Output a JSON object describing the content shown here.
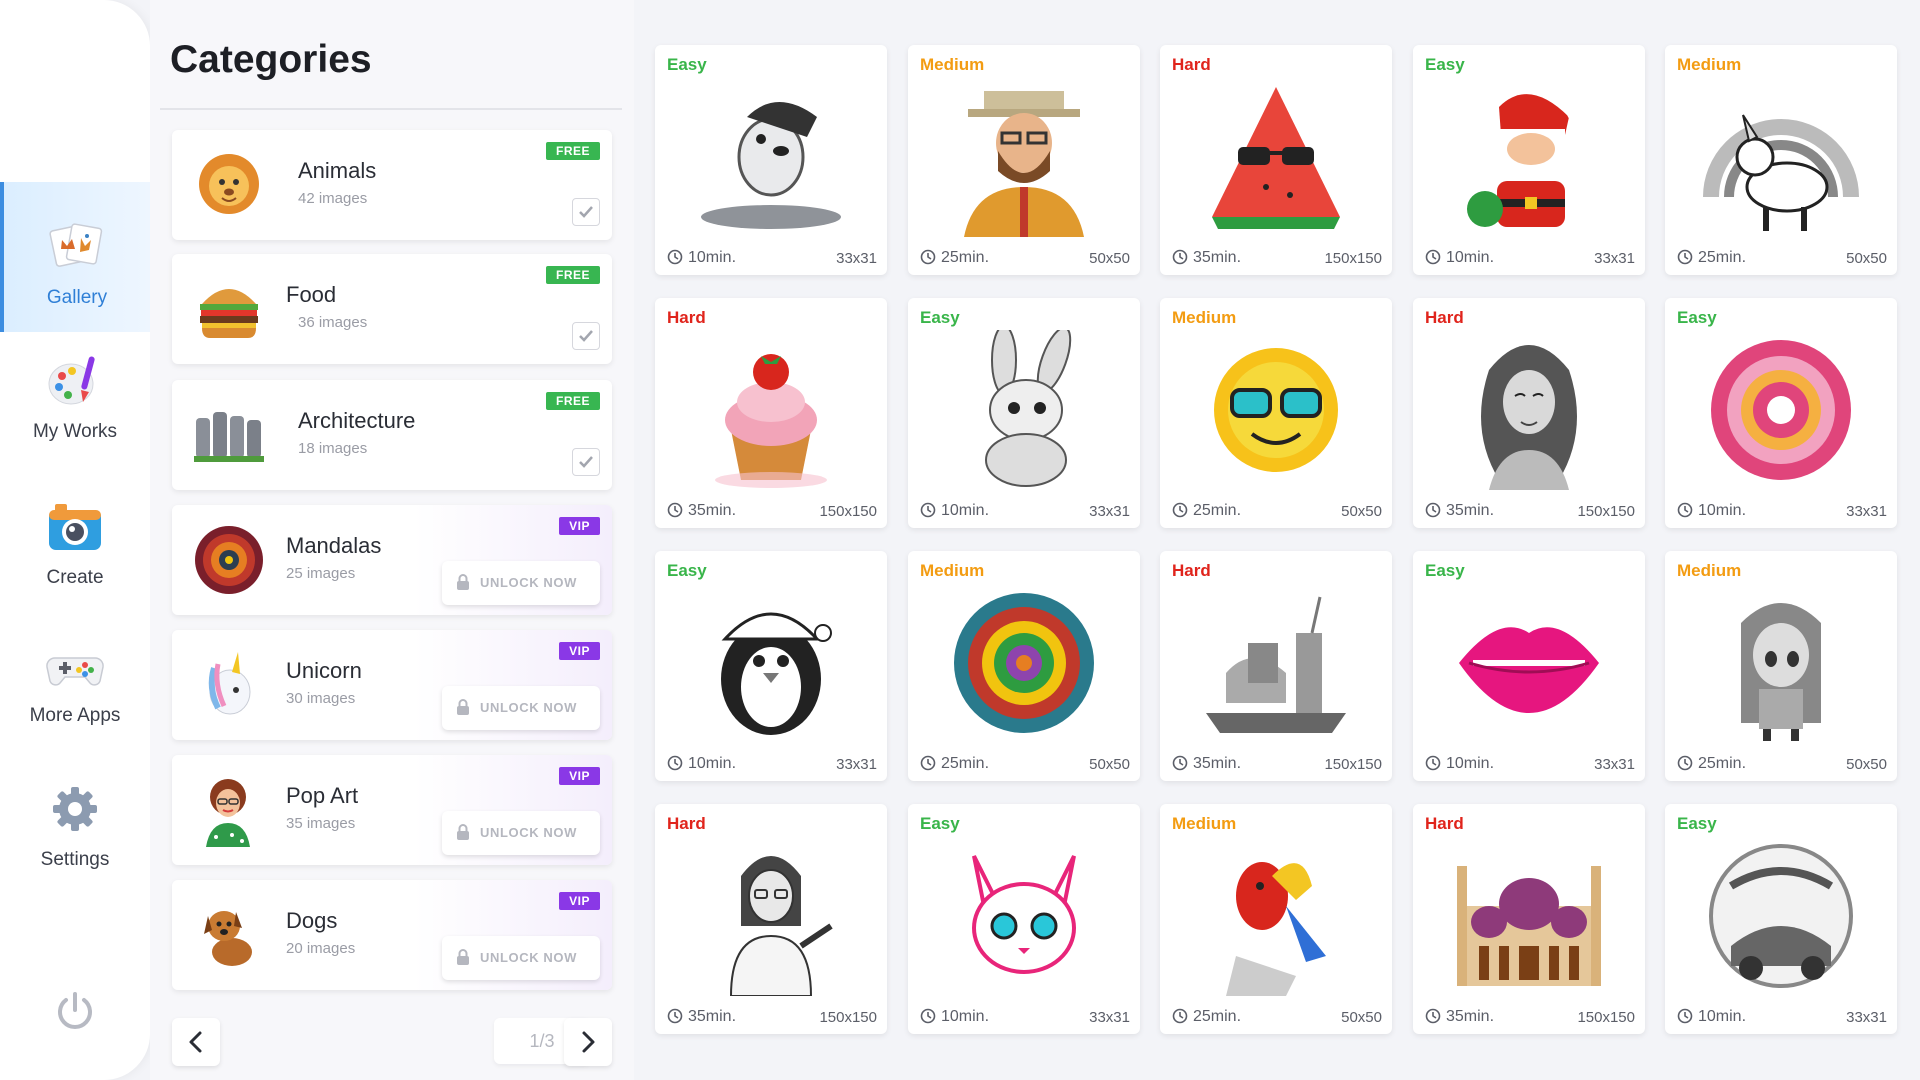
{
  "nav": {
    "items": [
      {
        "label": "Gallery",
        "icon": "gallery-icon",
        "active": true
      },
      {
        "label": "My Works",
        "icon": "palette-icon",
        "active": false
      },
      {
        "label": "Create",
        "icon": "camera-icon",
        "active": false
      },
      {
        "label": "More Apps",
        "icon": "gamepad-icon",
        "active": false
      },
      {
        "label": "Settings",
        "icon": "gear-icon",
        "active": false
      }
    ],
    "power_icon": "power-icon"
  },
  "categories": {
    "title": "Categories",
    "items": [
      {
        "name": "Animals",
        "count": "42 images",
        "badge": "FREE",
        "thumb": "lion"
      },
      {
        "name": "Food",
        "count": "36 images",
        "badge": "FREE",
        "thumb": "burger"
      },
      {
        "name": "Architecture",
        "count": "18 images",
        "badge": "FREE",
        "thumb": "moai"
      },
      {
        "name": "Mandalas",
        "count": "25 images",
        "badge": "VIP",
        "unlock": "UNLOCK NOW",
        "thumb": "mandala"
      },
      {
        "name": "Unicorn",
        "count": "30 images",
        "badge": "VIP",
        "unlock": "UNLOCK NOW",
        "thumb": "unicorn"
      },
      {
        "name": "Pop Art",
        "count": "35 images",
        "badge": "VIP",
        "unlock": "UNLOCK NOW",
        "thumb": "popart-woman"
      },
      {
        "name": "Dogs",
        "count": "20 images",
        "badge": "VIP",
        "unlock": "UNLOCK NOW",
        "thumb": "dog"
      }
    ],
    "pagination": {
      "indicator": "1/3"
    }
  },
  "gallery": [
    {
      "difficulty": "Easy",
      "time": "10min.",
      "size": "33x31",
      "art": "surfing-dog"
    },
    {
      "difficulty": "Medium",
      "time": "25min.",
      "size": "50x50",
      "art": "bearded-man"
    },
    {
      "difficulty": "Hard",
      "time": "35min.",
      "size": "150x150",
      "art": "watermelon-sunglasses"
    },
    {
      "difficulty": "Easy",
      "time": "10min.",
      "size": "33x31",
      "art": "santa-claus"
    },
    {
      "difficulty": "Medium",
      "time": "25min.",
      "size": "50x50",
      "art": "unicorn-rainbow"
    },
    {
      "difficulty": "Hard",
      "time": "35min.",
      "size": "150x150",
      "art": "cupcake"
    },
    {
      "difficulty": "Easy",
      "time": "10min.",
      "size": "33x31",
      "art": "bunny"
    },
    {
      "difficulty": "Medium",
      "time": "25min.",
      "size": "50x50",
      "art": "sun-sunglasses"
    },
    {
      "difficulty": "Hard",
      "time": "35min.",
      "size": "150x150",
      "art": "woman-portrait"
    },
    {
      "difficulty": "Easy",
      "time": "10min.",
      "size": "33x31",
      "art": "pink-mandala"
    },
    {
      "difficulty": "Easy",
      "time": "10min.",
      "size": "33x31",
      "art": "penguin-hat"
    },
    {
      "difficulty": "Medium",
      "time": "25min.",
      "size": "50x50",
      "art": "feather-mandala"
    },
    {
      "difficulty": "Hard",
      "time": "35min.",
      "size": "150x150",
      "art": "fast-food-tray"
    },
    {
      "difficulty": "Easy",
      "time": "10min.",
      "size": "33x31",
      "art": "pink-lips"
    },
    {
      "difficulty": "Medium",
      "time": "25min.",
      "size": "50x50",
      "art": "anime-girl"
    },
    {
      "difficulty": "Hard",
      "time": "35min.",
      "size": "150x150",
      "art": "woman-pointing"
    },
    {
      "difficulty": "Easy",
      "time": "10min.",
      "size": "33x31",
      "art": "white-cat"
    },
    {
      "difficulty": "Medium",
      "time": "25min.",
      "size": "50x50",
      "art": "parrot"
    },
    {
      "difficulty": "Hard",
      "time": "35min.",
      "size": "150x150",
      "art": "mosque"
    },
    {
      "difficulty": "Easy",
      "time": "10min.",
      "size": "33x31",
      "art": "lucky-strike-car"
    }
  ],
  "colors": {
    "easy": "#39b54a",
    "medium": "#f39c12",
    "hard": "#e0241c",
    "free_badge": "#38b651",
    "vip_badge": "#8a38e6",
    "accent": "#2f7fd6"
  }
}
